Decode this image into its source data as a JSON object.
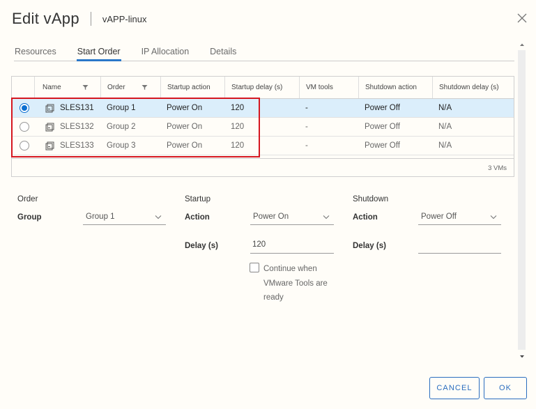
{
  "dialog": {
    "title": "Edit vApp",
    "subtitle": "vAPP-linux",
    "close_icon": "close-icon"
  },
  "tabs": [
    {
      "label": "Resources",
      "active": false
    },
    {
      "label": "Start Order",
      "active": true
    },
    {
      "label": "IP Allocation",
      "active": false
    },
    {
      "label": "Details",
      "active": false
    }
  ],
  "grid": {
    "columns": [
      "Name",
      "Order",
      "Startup action",
      "Startup delay (s)",
      "VM tools",
      "Shutdown action",
      "Shutdown delay (s)"
    ],
    "rows": [
      {
        "selected": true,
        "name": "SLES131",
        "order": "Group 1",
        "startup_action": "Power On",
        "startup_delay": "120",
        "vm_tools": "-",
        "shutdown_action": "Power Off",
        "shutdown_delay": "N/A"
      },
      {
        "selected": false,
        "name": "SLES132",
        "order": "Group 2",
        "startup_action": "Power On",
        "startup_delay": "120",
        "vm_tools": "-",
        "shutdown_action": "Power Off",
        "shutdown_delay": "N/A"
      },
      {
        "selected": false,
        "name": "SLES133",
        "order": "Group 3",
        "startup_action": "Power On",
        "startup_delay": "120",
        "vm_tools": "-",
        "shutdown_action": "Power Off",
        "shutdown_delay": "N/A"
      }
    ],
    "footer_count": "3 VMs"
  },
  "form": {
    "order": {
      "title": "Order",
      "group_label": "Group",
      "group_value": "Group 1"
    },
    "startup": {
      "title": "Startup",
      "action_label": "Action",
      "action_value": "Power On",
      "delay_label": "Delay (s)",
      "delay_value": "120",
      "checkbox_label": "Continue when VMware Tools are ready",
      "checkbox_checked": false
    },
    "shutdown": {
      "title": "Shutdown",
      "action_label": "Action",
      "action_value": "Power Off",
      "delay_label": "Delay (s)",
      "delay_value": ""
    }
  },
  "buttons": {
    "cancel": "CANCEL",
    "ok": "OK"
  },
  "colors": {
    "accent": "#2a77c9",
    "selected_row": "#dbeefb",
    "highlight": "#d5161f"
  }
}
